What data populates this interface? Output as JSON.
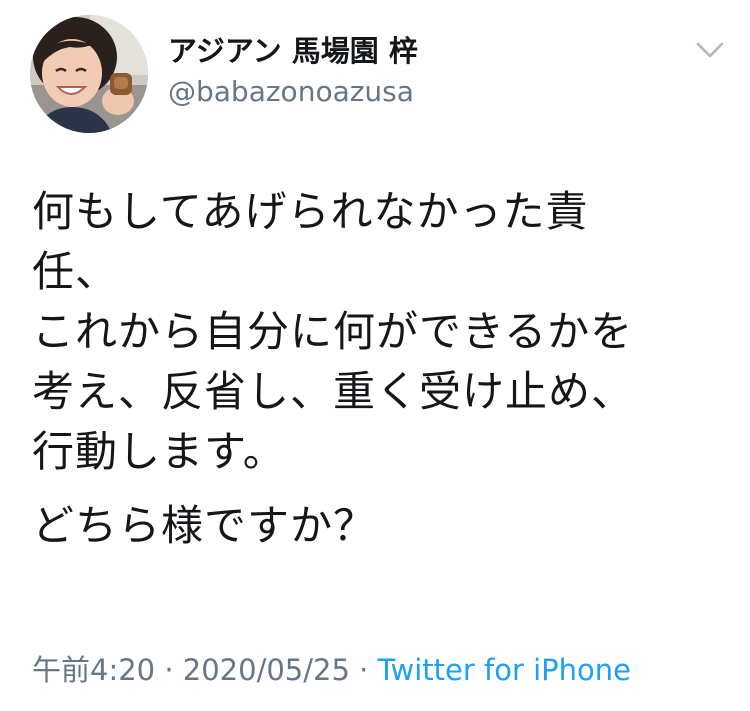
{
  "author": {
    "display_name": "アジアン 馬場園 梓",
    "handle": "@babazonoazusa"
  },
  "icons": {
    "menu": "chevron-down-icon",
    "avatar": "profile-photo"
  },
  "tweet": {
    "lines": [
      "何もしてあげられなかった責",
      "任、",
      "これから自分に何ができるかを",
      "考え、反省し、重く受け止め、",
      "行動します。"
    ],
    "second_paragraph": "どちら様ですか？"
  },
  "meta": {
    "time": "午前4:20",
    "separator": " · ",
    "date": "2020/05/25",
    "source": "Twitter for iPhone"
  },
  "colors": {
    "text": "#14171a",
    "secondary": "#657786",
    "link": "#1da1f2"
  }
}
